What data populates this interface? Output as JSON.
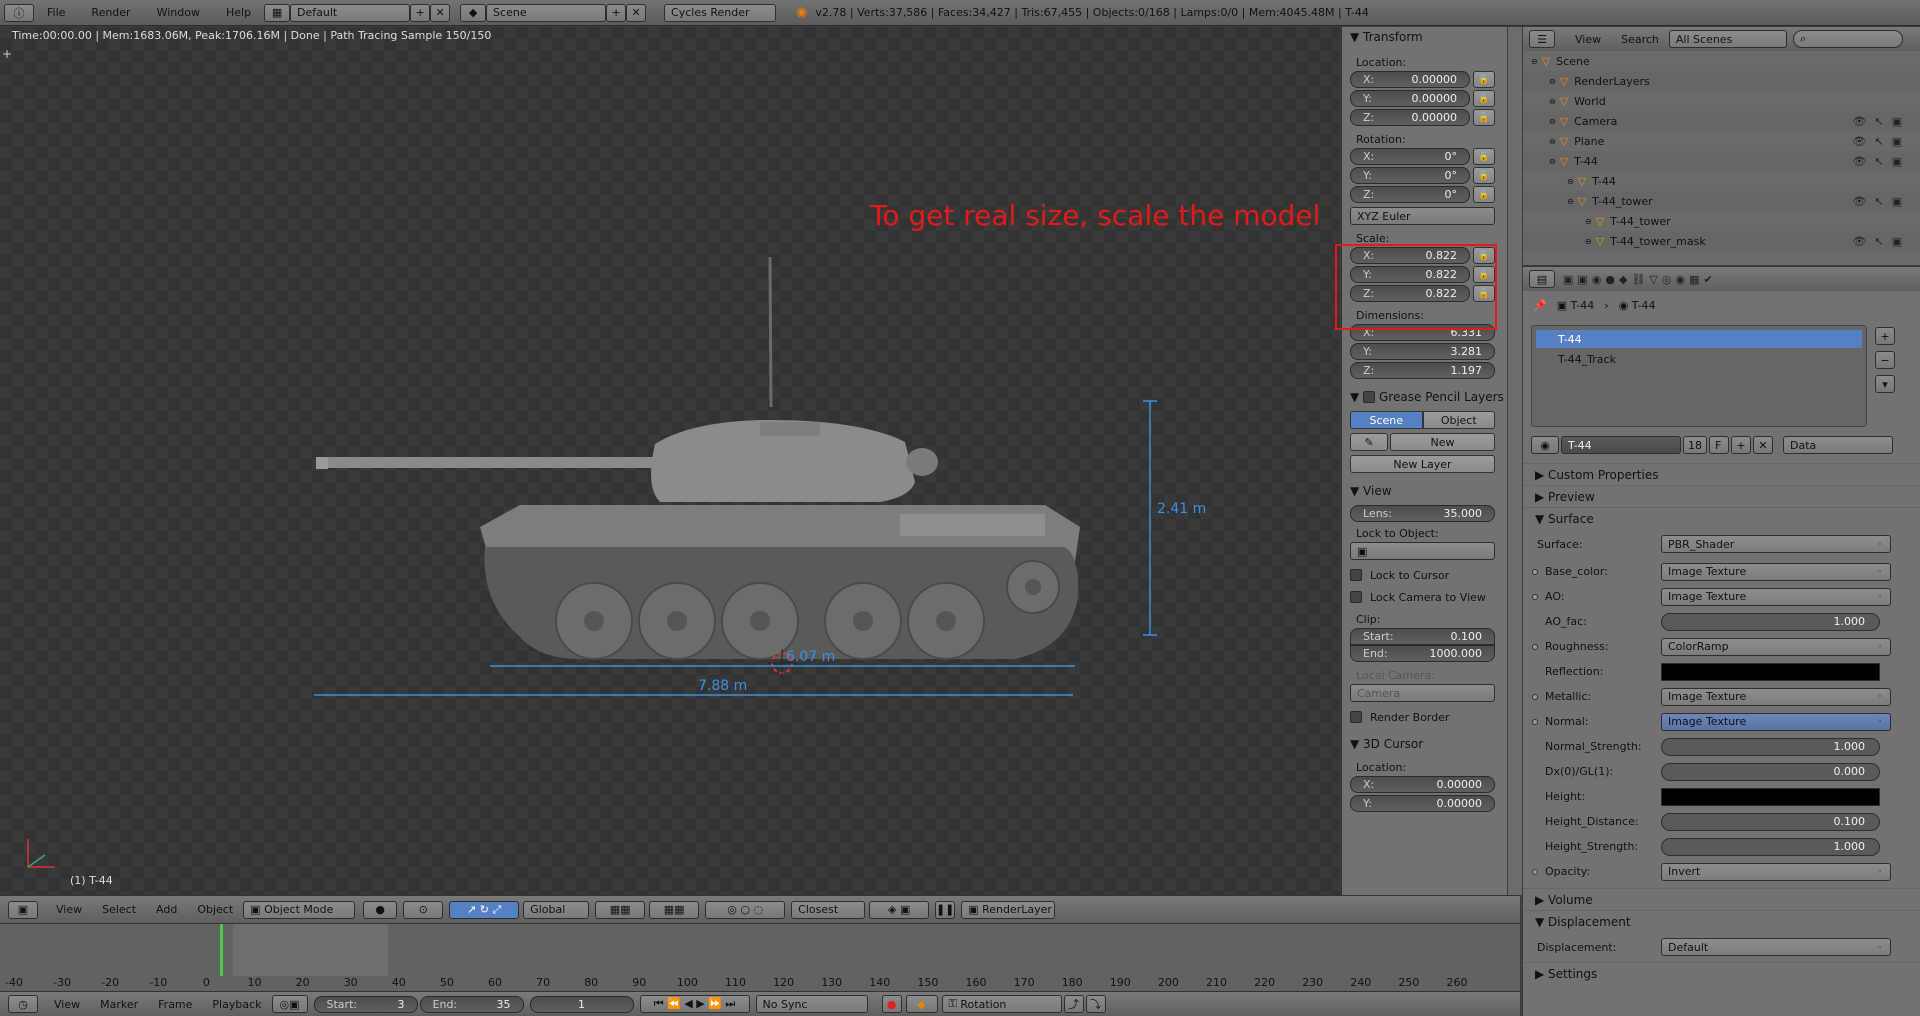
{
  "topbar": {
    "menus": [
      "File",
      "Render",
      "Window",
      "Help"
    ],
    "layout": "Default",
    "scene": "Scene",
    "engine": "Cycles Render",
    "stats": "v2.78 | Verts:37,586 | Faces:34,427 | Tris:67,455 | Objects:0/168 | Lamps:0/0 | Mem:4045.48M | T-44"
  },
  "viewport": {
    "status": "Time:00:00.00 | Mem:1683.06M, Peak:1706.16M | Done | Path Tracing Sample 150/150",
    "annotation": "To get real size, scale the model",
    "dim_height": "2.41 m",
    "dim_length1": "6.07 m",
    "dim_length2": "7.88 m",
    "object_label": "(1) T-44",
    "annotation_color": "#e11a1a",
    "dimension_color": "#3d8fe0"
  },
  "npanel": {
    "transform_title": "Transform",
    "location_label": "Location:",
    "location": [
      {
        "ax": "X:",
        "v": "0.00000"
      },
      {
        "ax": "Y:",
        "v": "0.00000"
      },
      {
        "ax": "Z:",
        "v": "0.00000"
      }
    ],
    "rotation_label": "Rotation:",
    "rotation": [
      {
        "ax": "X:",
        "v": "0°"
      },
      {
        "ax": "Y:",
        "v": "0°"
      },
      {
        "ax": "Z:",
        "v": "0°"
      }
    ],
    "rotation_mode": "XYZ Euler",
    "scale_label": "Scale:",
    "scale": [
      {
        "ax": "X:",
        "v": "0.822"
      },
      {
        "ax": "Y:",
        "v": "0.822"
      },
      {
        "ax": "Z:",
        "v": "0.822"
      }
    ],
    "dimensions_label": "Dimensions:",
    "dimensions": [
      {
        "ax": "X:",
        "v": "6.331"
      },
      {
        "ax": "Y:",
        "v": "3.281"
      },
      {
        "ax": "Z:",
        "v": "1.197"
      }
    ],
    "grease_title": "Grease Pencil Layers",
    "scene_tab": "Scene",
    "object_tab": "Object",
    "new_btn": "New",
    "new_layer_btn": "New Layer",
    "view_title": "View",
    "lens_label": "Lens:",
    "lens_value": "35.000",
    "lock_object_label": "Lock to Object:",
    "lock_cursor": "Lock to Cursor",
    "lock_camera": "Lock Camera to View",
    "clip_label": "Clip:",
    "clip_start_label": "Start:",
    "clip_start": "0.100",
    "clip_end_label": "End:",
    "clip_end": "1000.000",
    "local_camera_label": "Local Camera:",
    "local_camera": "Camera",
    "render_border": "Render Border",
    "cursor_title": "3D Cursor",
    "cursor_location_label": "Location:",
    "cursor_location": [
      {
        "ax": "X:",
        "v": "0.00000"
      },
      {
        "ax": "Y:",
        "v": "0.00000"
      }
    ]
  },
  "outliner": {
    "view": "View",
    "search": "Search",
    "filter": "All Scenes",
    "items": [
      {
        "label": "Scene",
        "indent": 0
      },
      {
        "label": "RenderLayers",
        "indent": 1
      },
      {
        "label": "World",
        "indent": 1
      },
      {
        "label": "Camera",
        "indent": 1
      },
      {
        "label": "Plane",
        "indent": 1
      },
      {
        "label": "T-44",
        "indent": 1
      },
      {
        "label": "T-44",
        "indent": 2
      },
      {
        "label": "T-44_tower",
        "indent": 2
      },
      {
        "label": "T-44_tower",
        "indent": 3
      },
      {
        "label": "T-44_tower_mask",
        "indent": 3
      }
    ]
  },
  "properties": {
    "breadcrumb1": "T-44",
    "breadcrumb2": "T-44",
    "materials": [
      "T-44",
      "T-44_Track"
    ],
    "material_name": "T-44",
    "users": "18",
    "fake": "F",
    "link": "Data",
    "custom_props": "Custom Properties",
    "preview": "Preview",
    "surface_title": "Surface",
    "surface_label": "Surface:",
    "surface_value": "PBR_Shader",
    "inputs": [
      {
        "label": "Base_color:",
        "kind": "menu",
        "value": "Image Texture",
        "dot": true
      },
      {
        "label": "AO:",
        "kind": "menu",
        "value": "Image Texture",
        "dot": true
      },
      {
        "label": "AO_fac:",
        "kind": "slider",
        "value": "1.000",
        "dot": false
      },
      {
        "label": "Roughness:",
        "kind": "menu",
        "value": "ColorRamp",
        "dot": true
      },
      {
        "label": "Reflection:",
        "kind": "color",
        "value": "",
        "dot": false
      },
      {
        "label": "Metallic:",
        "kind": "menu",
        "value": "Image Texture",
        "dot": true
      },
      {
        "label": "Normal:",
        "kind": "menu",
        "value": "Image Texture",
        "dot": true
      },
      {
        "label": "Normal_Strength:",
        "kind": "slider",
        "value": "1.000",
        "dot": false
      },
      {
        "label": "Dx(0)/GL(1):",
        "kind": "slider",
        "value": "0.000",
        "dot": false
      },
      {
        "label": "Height:",
        "kind": "color",
        "value": "",
        "dot": false
      },
      {
        "label": "Height_Distance:",
        "kind": "slider",
        "value": "0.100",
        "dot": false
      },
      {
        "label": "Height_Strength:",
        "kind": "slider",
        "value": "1.000",
        "dot": false
      },
      {
        "label": "Opacity:",
        "kind": "menu",
        "value": "Invert",
        "dot": true
      }
    ],
    "volume": "Volume",
    "displacement_title": "Displacement",
    "displacement_label": "Displacement:",
    "displacement_value": "Default",
    "settings": "Settings"
  },
  "view3d_header": {
    "menus": [
      "View",
      "Select",
      "Add",
      "Object"
    ],
    "mode": "Object Mode",
    "orientation": "Global",
    "snap": "Closest",
    "render_layer": "RenderLayer"
  },
  "timeline": {
    "ticks": [
      "-40",
      "-30",
      "-20",
      "-10",
      "0",
      "10",
      "20",
      "30",
      "40",
      "50",
      "60",
      "70",
      "80",
      "90",
      "100",
      "110",
      "120",
      "130",
      "140",
      "150",
      "160",
      "170",
      "180",
      "190",
      "200",
      "210",
      "220",
      "230",
      "240",
      "250",
      "260"
    ],
    "menus": [
      "View",
      "Marker",
      "Frame",
      "Playback"
    ],
    "start_label": "Start:",
    "start": "3",
    "end_label": "End:",
    "end": "35",
    "current": "1",
    "sync": "No Sync",
    "keying": "Rotation"
  }
}
